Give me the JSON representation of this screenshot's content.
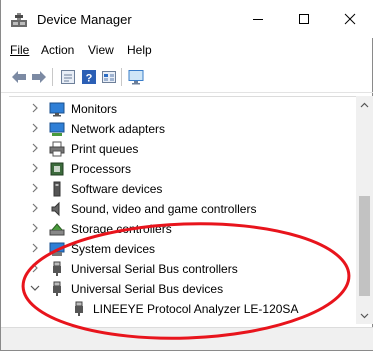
{
  "window": {
    "title": "Device Manager"
  },
  "menu": [
    "File",
    "Action",
    "View",
    "Help"
  ],
  "tree": {
    "items": [
      {
        "label": "Monitors",
        "icon": "monitor-icon",
        "expanded": false
      },
      {
        "label": "Network adapters",
        "icon": "network-adapter-icon",
        "expanded": false
      },
      {
        "label": "Print queues",
        "icon": "printer-icon",
        "expanded": false
      },
      {
        "label": "Processors",
        "icon": "processor-icon",
        "expanded": false
      },
      {
        "label": "Software devices",
        "icon": "software-device-icon",
        "expanded": false
      },
      {
        "label": "Sound, video and game controllers",
        "icon": "speaker-icon",
        "expanded": false
      },
      {
        "label": "Storage controllers",
        "icon": "storage-controller-icon",
        "expanded": false
      },
      {
        "label": "System devices",
        "icon": "system-devices-icon",
        "expanded": false
      },
      {
        "label": "Universal Serial Bus controllers",
        "icon": "usb-plug-icon",
        "expanded": false
      },
      {
        "label": "Universal Serial Bus devices",
        "icon": "usb-plug-icon",
        "expanded": true
      },
      {
        "label": "LINEEYE Protocol Analyzer LE-120SA",
        "icon": "usb-plug-icon",
        "child": true
      }
    ]
  },
  "colors": {
    "annotation": "#e8141c",
    "accent": "#2b6cc4"
  }
}
